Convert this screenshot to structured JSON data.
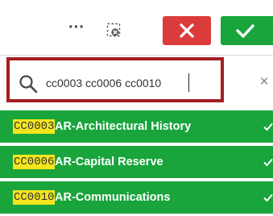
{
  "toolbar": {
    "more_label": "···"
  },
  "search": {
    "value": "cc0003 cc0006 cc0010"
  },
  "results": [
    {
      "code": "CC0003",
      "name": "AR-Architectural History"
    },
    {
      "code": "CC0006",
      "name": "AR-Capital Reserve"
    },
    {
      "code": "CC0010",
      "name": "AR-Communications"
    }
  ],
  "colors": {
    "selected_green": "#19a53c",
    "cancel_red": "#dc3b3b",
    "match_highlight": "#f5e51c",
    "annotation_outline": "#a31e22"
  },
  "icons": {
    "more": "more-horizontal-icon",
    "lasso": "lasso-select-icon",
    "cancel": "close-icon",
    "confirm": "check-icon",
    "search": "search-icon",
    "clear": "clear-icon",
    "row_selected": "check-icon"
  }
}
